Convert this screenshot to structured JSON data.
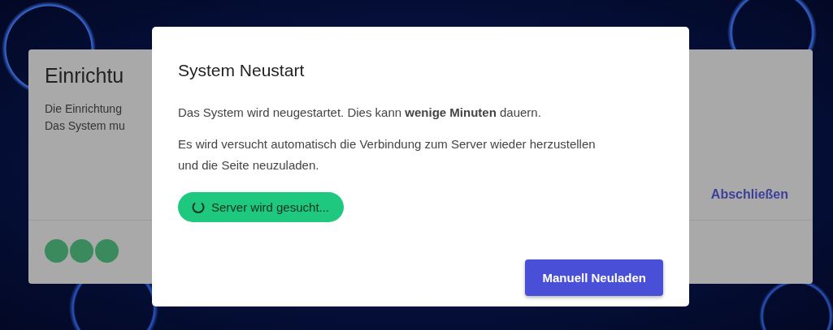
{
  "card": {
    "title": "Einrichtu",
    "lines": [
      "Die Einrichtung",
      "Das System mu"
    ],
    "finish_link": "Abschließen"
  },
  "dialog": {
    "title": "System Neustart",
    "paragraphs": [
      "Das System wird neugestartet. Dies kann **wenige Minuten** dauern.",
      "Es wird versucht automatisch die Verbindung zum Server wieder herzustellen und die Seite neuzuladen."
    ],
    "status": "Server wird gesucht...",
    "button": "Manuell Neuladen"
  }
}
